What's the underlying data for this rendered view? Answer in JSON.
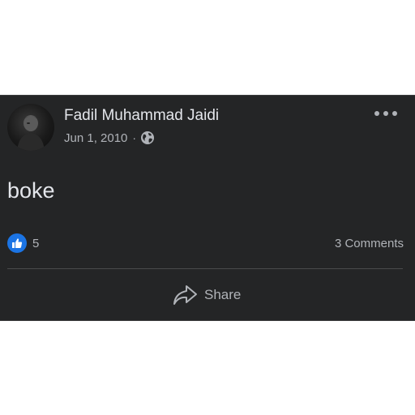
{
  "post": {
    "author": "Fadil Muhammad Jaidi",
    "date": "Jun 1, 2010",
    "separator": "·",
    "privacy_icon": "globe-icon",
    "body": "boke",
    "reaction_icon": "thumbs-up-icon",
    "reaction_count": "5",
    "comments_label": "3 Comments",
    "share_label": "Share"
  },
  "colors": {
    "card_background": "#242526",
    "primary_text": "#e4e6eb",
    "secondary_text": "#b0b3b8",
    "like_blue": "#1b74e4"
  }
}
